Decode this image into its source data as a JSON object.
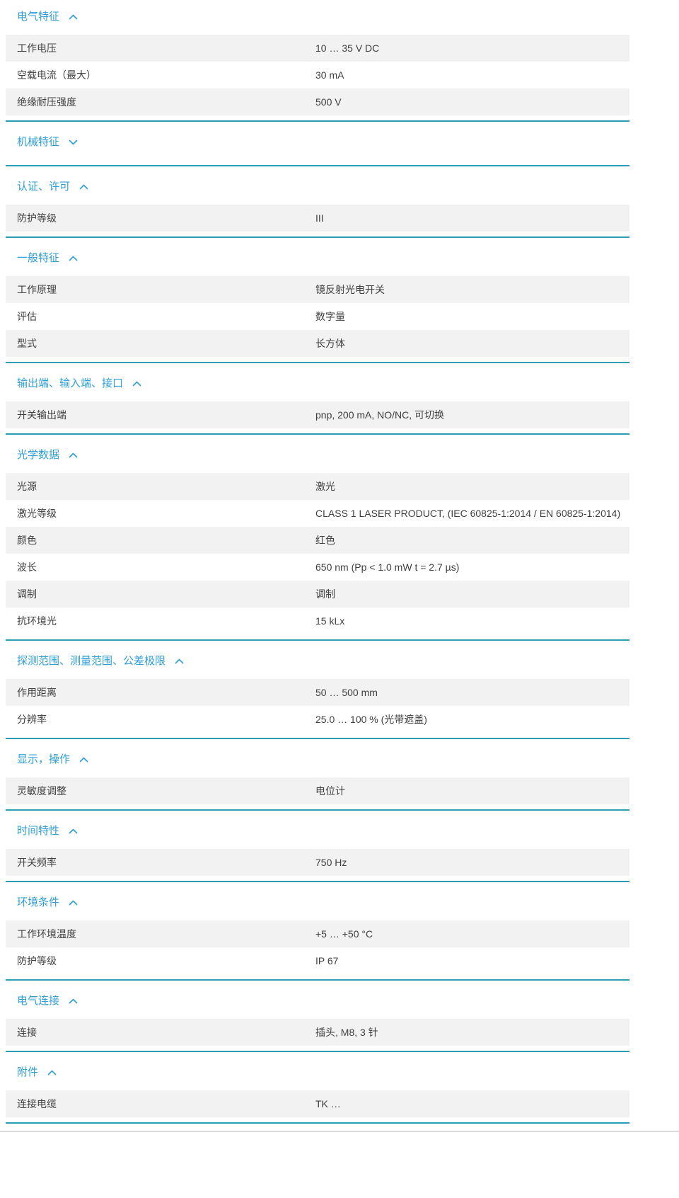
{
  "colors": {
    "header_blue": "#2f9fd6",
    "section_border_teal": "#2c9cb5",
    "row_background_gray": "#f2f2f2",
    "body_text": "#404040"
  },
  "icons": {
    "expanded": "chevron-up-icon",
    "collapsed": "chevron-down-icon"
  },
  "sections": [
    {
      "title": "电气特征",
      "expanded": true,
      "rows": [
        {
          "label": "工作电压",
          "value": "10 … 35 V DC"
        },
        {
          "label": "空载电流（最大）",
          "value": "30 mA"
        },
        {
          "label": "绝缘耐压强度",
          "value": "500 V"
        }
      ]
    },
    {
      "title": "机械特征",
      "expanded": false,
      "rows": []
    },
    {
      "title": "认证、许可",
      "expanded": true,
      "rows": [
        {
          "label": "防护等级",
          "value": "III"
        }
      ]
    },
    {
      "title": "一般特征",
      "expanded": true,
      "rows": [
        {
          "label": "工作原理",
          "value": "镜反射光电开关"
        },
        {
          "label": "评估",
          "value": "数字量"
        },
        {
          "label": "型式",
          "value": "长方体"
        }
      ]
    },
    {
      "title": "输出端、输入端、接口",
      "expanded": true,
      "rows": [
        {
          "label": "开关输出端",
          "value": "pnp, 200 mA, NO/NC, 可切换"
        }
      ]
    },
    {
      "title": "光学数据",
      "expanded": true,
      "rows": [
        {
          "label": "光源",
          "value": "激光"
        },
        {
          "label": "激光等级",
          "value": "CLASS 1 LASER PRODUCT, (IEC 60825-1:2014 / EN 60825-1:2014)"
        },
        {
          "label": "颜色",
          "value": "红色"
        },
        {
          "label": "波长",
          "value": "650 nm (Pp < 1.0 mW t = 2.7 µs)"
        },
        {
          "label": "调制",
          "value": "调制"
        },
        {
          "label": "抗环境光",
          "value": "15 kLx"
        }
      ]
    },
    {
      "title": "探测范围、测量范围、公差极限",
      "expanded": true,
      "rows": [
        {
          "label": "作用距离",
          "value": "50 … 500 mm"
        },
        {
          "label": "分辨率",
          "value": "25.0 … 100 % (光带遮盖)"
        }
      ]
    },
    {
      "title": "显示，操作",
      "expanded": true,
      "rows": [
        {
          "label": "灵敏度调整",
          "value": "电位计"
        }
      ]
    },
    {
      "title": "时间特性",
      "expanded": true,
      "rows": [
        {
          "label": "开关频率",
          "value": "750 Hz"
        }
      ]
    },
    {
      "title": "环境条件",
      "expanded": true,
      "rows": [
        {
          "label": "工作环境温度",
          "value": "+5 … +50 °C"
        },
        {
          "label": "防护等级",
          "value": "IP 67"
        }
      ]
    },
    {
      "title": "电气连接",
      "expanded": true,
      "rows": [
        {
          "label": "连接",
          "value": "插头, M8, 3 针"
        }
      ]
    },
    {
      "title": "附件",
      "expanded": true,
      "rows": [
        {
          "label": "连接电缆",
          "value": "TK …"
        }
      ]
    }
  ]
}
